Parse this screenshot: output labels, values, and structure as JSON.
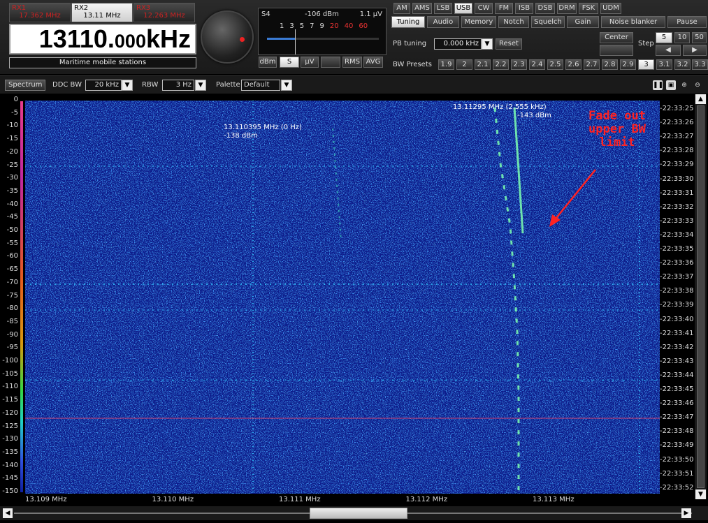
{
  "rx_tabs": [
    {
      "name": "RX1",
      "freq": "17.362 MHz",
      "active": false
    },
    {
      "name": "RX2",
      "freq": "13.11 MHz",
      "active": true
    },
    {
      "name": "RX3",
      "freq": "12.263 MHz",
      "active": false
    }
  ],
  "frequency": {
    "main": "13110.",
    "fraction": "000",
    "unit": "kHz"
  },
  "band_label": "Maritime mobile stations",
  "smeter": {
    "level": "S4",
    "dbm": "-106 dBm",
    "uv": "1.1 µV",
    "scale_white": [
      "1",
      "3",
      "5",
      "7",
      "9"
    ],
    "scale_red": [
      "20",
      "40",
      "60"
    ],
    "buttons": [
      "dBm",
      "S",
      "µV",
      "",
      "RMS",
      "AVG"
    ],
    "level_fraction": 0.25
  },
  "modes": [
    "AM",
    "AMS",
    "LSB",
    "USB",
    "CW",
    "FM",
    "ISB",
    "DSB",
    "DRM",
    "FSK",
    "UDM"
  ],
  "active_mode": "USB",
  "tabs": [
    "Tuning",
    "Audio",
    "Memory",
    "Notch",
    "Squelch",
    "Gain",
    "Noise blanker",
    "Pause"
  ],
  "tuning": {
    "pb_label": "PB tuning",
    "pb_value": "0.000 kHz",
    "reset": "Reset",
    "center": "Center",
    "step_label": "Step",
    "steps": [
      "5",
      "10",
      "50"
    ],
    "left_arrow": "◀",
    "right_arrow": "▶",
    "bw_label": "BW Presets",
    "bw_presets": [
      "1.9",
      "2",
      "2.1",
      "2.2",
      "2.3",
      "2.4",
      "2.5",
      "2.6",
      "2.7",
      "2.8",
      "2.9",
      "3",
      "3.1",
      "3.2",
      "3.3"
    ],
    "bw_active": "3"
  },
  "toolbar": {
    "spectrum": "Spectrum",
    "ddc_label": "DDC BW",
    "ddc_value": "20 kHz",
    "rbw_label": "RBW",
    "rbw_value": "3 Hz",
    "palette_label": "Palette",
    "palette_value": "Default"
  },
  "y_labels": [
    "0",
    "-5",
    "-10",
    "-15",
    "-20",
    "-25",
    "-30",
    "-35",
    "-40",
    "-45",
    "-50",
    "-55",
    "-60",
    "-65",
    "-70",
    "-75",
    "-80",
    "-85",
    "-90",
    "-95",
    "-100",
    "-105",
    "-110",
    "-115",
    "-120",
    "-125",
    "-130",
    "-135",
    "-140",
    "-145",
    "-150"
  ],
  "x_labels": [
    "13.109 MHz",
    "13.110 MHz",
    "13.111 MHz",
    "13.112 MHz",
    "13.113 MHz"
  ],
  "time_labels": [
    "22:33:25",
    "22:33:26",
    "22:33:27",
    "22:33:28",
    "22:33:29",
    "22:33:30",
    "22:33:31",
    "22:33:32",
    "22:33:33",
    "22:33:34",
    "22:33:35",
    "22:33:36",
    "22:33:37",
    "22:33:38",
    "22:33:39",
    "22:33:40",
    "22:33:41",
    "22:33:42",
    "22:33:43",
    "22:33:44",
    "22:33:45",
    "22:33:46",
    "22:33:47",
    "22:33:48",
    "22:33:49",
    "22:33:50",
    "22:33:51",
    "22:33:52"
  ],
  "marker1": {
    "freq": "13.110395 MHz (0 Hz)",
    "level": "-138 dBm"
  },
  "marker2": {
    "freq": "13.11295 MHz (2.555 kHz)",
    "level": "-143 dBm"
  },
  "annotation": [
    "Fade out",
    "upper BW",
    "limit"
  ],
  "colors": {
    "accent_red": "#ff2222",
    "waterfall_bg": "#0a1a8c",
    "signal": "#7dffb0"
  }
}
